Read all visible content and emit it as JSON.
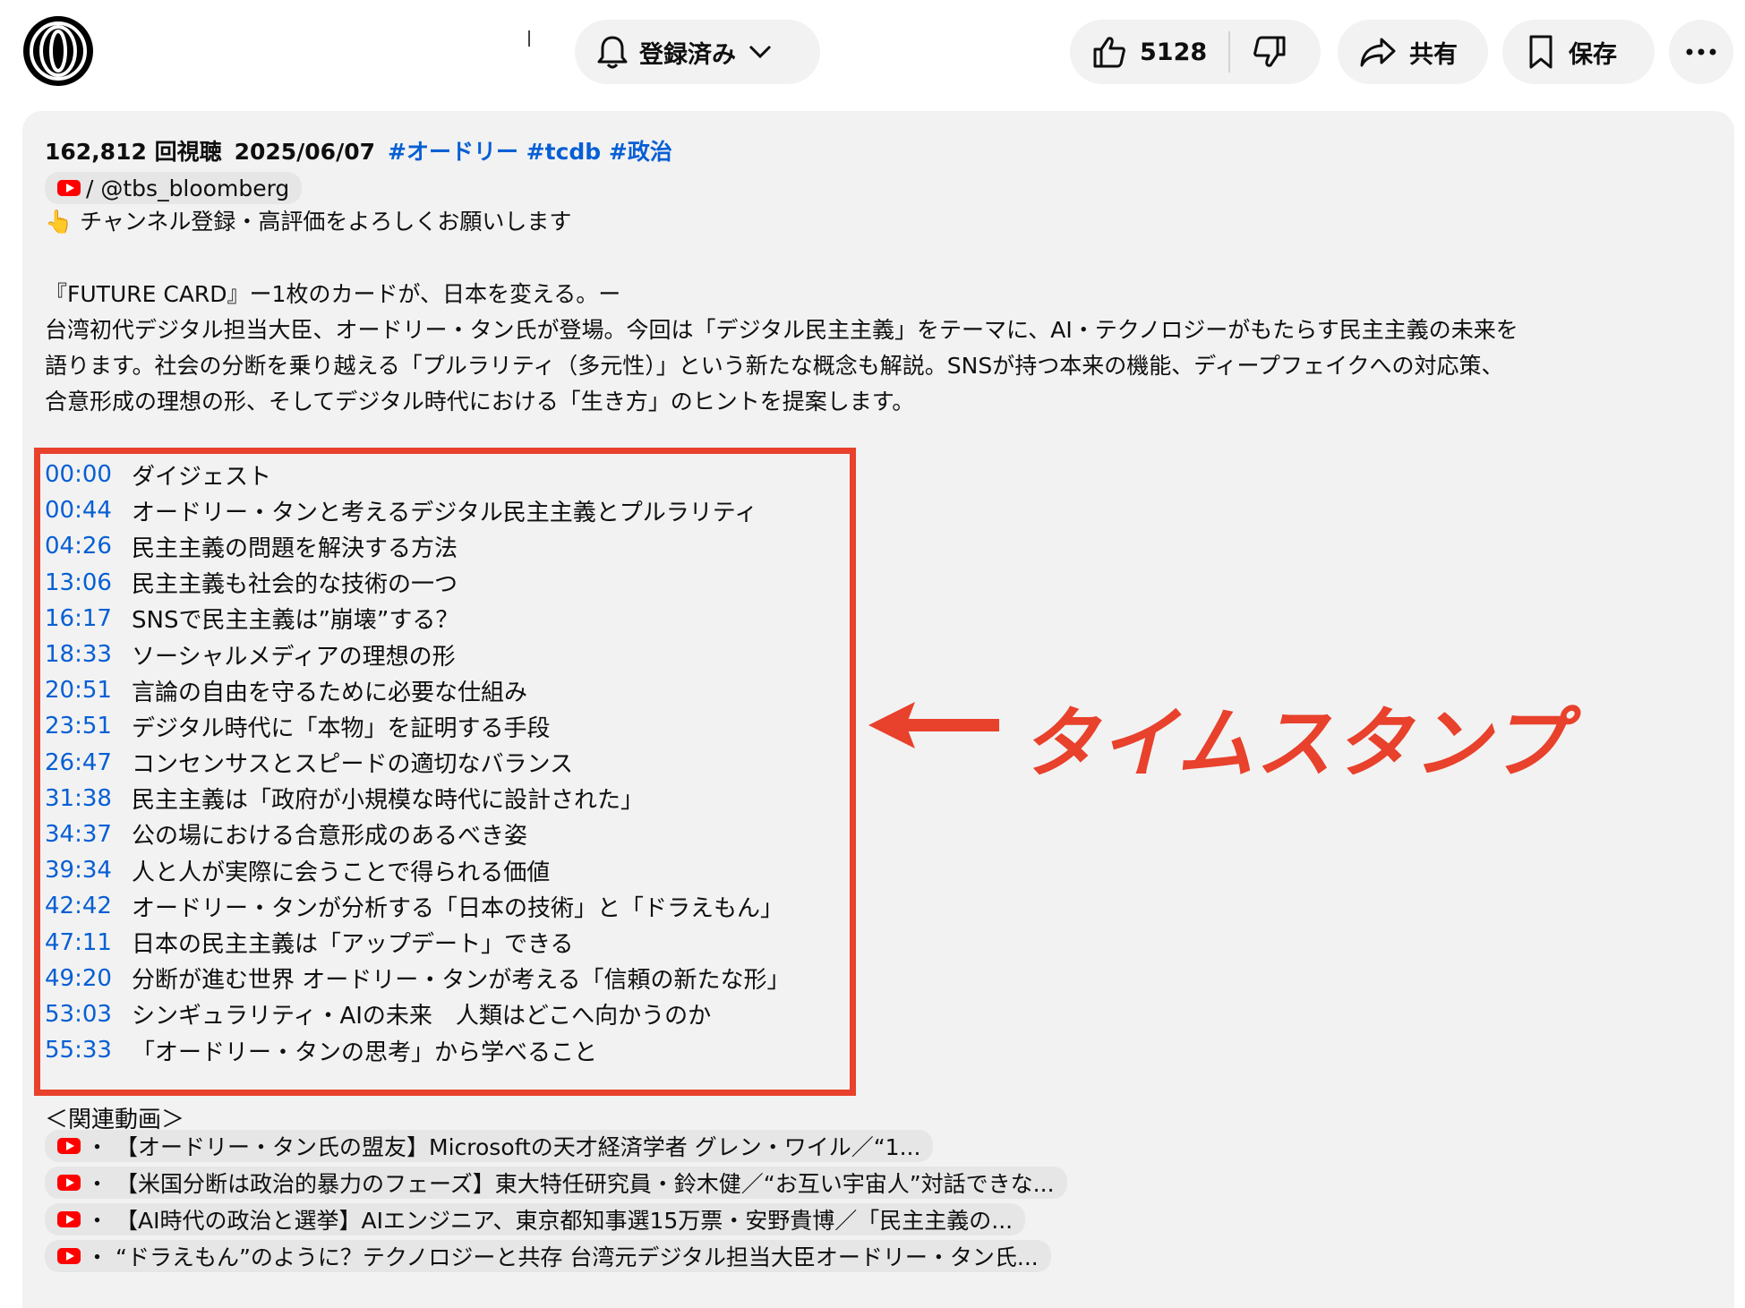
{
  "toolbar": {
    "subscribe_label": "登録済み",
    "like_count": "5128",
    "share_label": "共有",
    "save_label": "保存",
    "more_label": "···"
  },
  "description": {
    "views": "162,812 回視聴",
    "date": "2025/06/07",
    "hashtags": [
      "#オードリー",
      "#tcdb",
      "#政治"
    ],
    "channel_handle": "/ @tbs_bloomberg",
    "subscribe_prompt": "👆 チャンネル登録・高評価をよろしくお願いします",
    "paragraph": [
      "『FUTURE CARD』ー1枚のカードが、日本を変える。ー",
      "台湾初代デジタル担当大臣、オードリー・タン氏が登場。今回は「デジタル民主主義」をテーマに、AI・テクノロジーがもたらす民主主義の未来を",
      "語ります。社会の分断を乗り越える「プルラリティ（多元性）」という新たな概念も解説。SNSが持つ本来の機能、ディープフェイクへの対応策、",
      "合意形成の理想の形、そしてデジタル時代における「生き方」のヒントを提案します。"
    ]
  },
  "timestamps": [
    {
      "time": "00:00",
      "title": "ダイジェスト"
    },
    {
      "time": "00:44",
      "title": "オードリー・タンと考えるデジタル民主主義とプルラリティ"
    },
    {
      "time": "04:26",
      "title": "民主主義の問題を解決する方法"
    },
    {
      "time": "13:06",
      "title": "民主主義も社会的な技術の一つ"
    },
    {
      "time": "16:17",
      "title": "SNSで民主主義は”崩壊”する？"
    },
    {
      "time": "18:33",
      "title": "ソーシャルメディアの理想の形"
    },
    {
      "time": "20:51",
      "title": "言論の自由を守るために必要な仕組み"
    },
    {
      "time": "23:51",
      "title": "デジタル時代に「本物」を証明する手段"
    },
    {
      "time": "26:47",
      "title": "コンセンサスとスピードの適切なバランス"
    },
    {
      "time": "31:38",
      "title": "民主主義は「政府が小規模な時代に設計された」"
    },
    {
      "time": "34:37",
      "title": "公の場における合意形成のあるべき姿"
    },
    {
      "time": "39:34",
      "title": "人と人が実際に会うことで得られる価値"
    },
    {
      "time": "42:42",
      "title": "オードリー・タンが分析する「日本の技術」と「ドラえもん」"
    },
    {
      "time": "47:11",
      "title": "日本の民主主義は「アップデート」できる"
    },
    {
      "time": "49:20",
      "title": "分断が進む世界 オードリー・タンが考える「信頼の新たな形」"
    },
    {
      "time": "53:03",
      "title": "シンギュラリティ・AIの未来　人類はどこへ向かうのか"
    },
    {
      "time": "55:33",
      "title": "「オードリー・タンの思考」から学べること"
    }
  ],
  "annotation": {
    "arrow": "←",
    "label": "タイムスタンプ",
    "color": "#e8412c"
  },
  "related": {
    "heading": "＜関連動画＞",
    "items": [
      "【オードリー・タン氏の盟友】Microsoftの天才経済学者 グレン・ワイル／“1...",
      "【米国分断は政治的暴力のフェーズ】東大特任研究員・鈴木健／“お互い宇宙人”対話できな...",
      "【AI時代の政治と選挙】AIエンジニア、東京都知事選15万票・安野貴博／「民主主義の...",
      "“ドラえもん”のように？テクノロジーと共存 台湾元デジタル担当大臣オードリー・タン氏..."
    ]
  },
  "colors": {
    "link": "#065fd4",
    "pill_bg": "#f2f2f2",
    "highlight": "#e8412c",
    "youtube_red": "#ff0000"
  },
  "icons": [
    "channel-logo",
    "bell-icon",
    "chevron-down-icon",
    "thumbs-up-icon",
    "thumbs-down-icon",
    "share-arrow-icon",
    "bookmark-icon",
    "more-icon",
    "youtube-icon"
  ]
}
